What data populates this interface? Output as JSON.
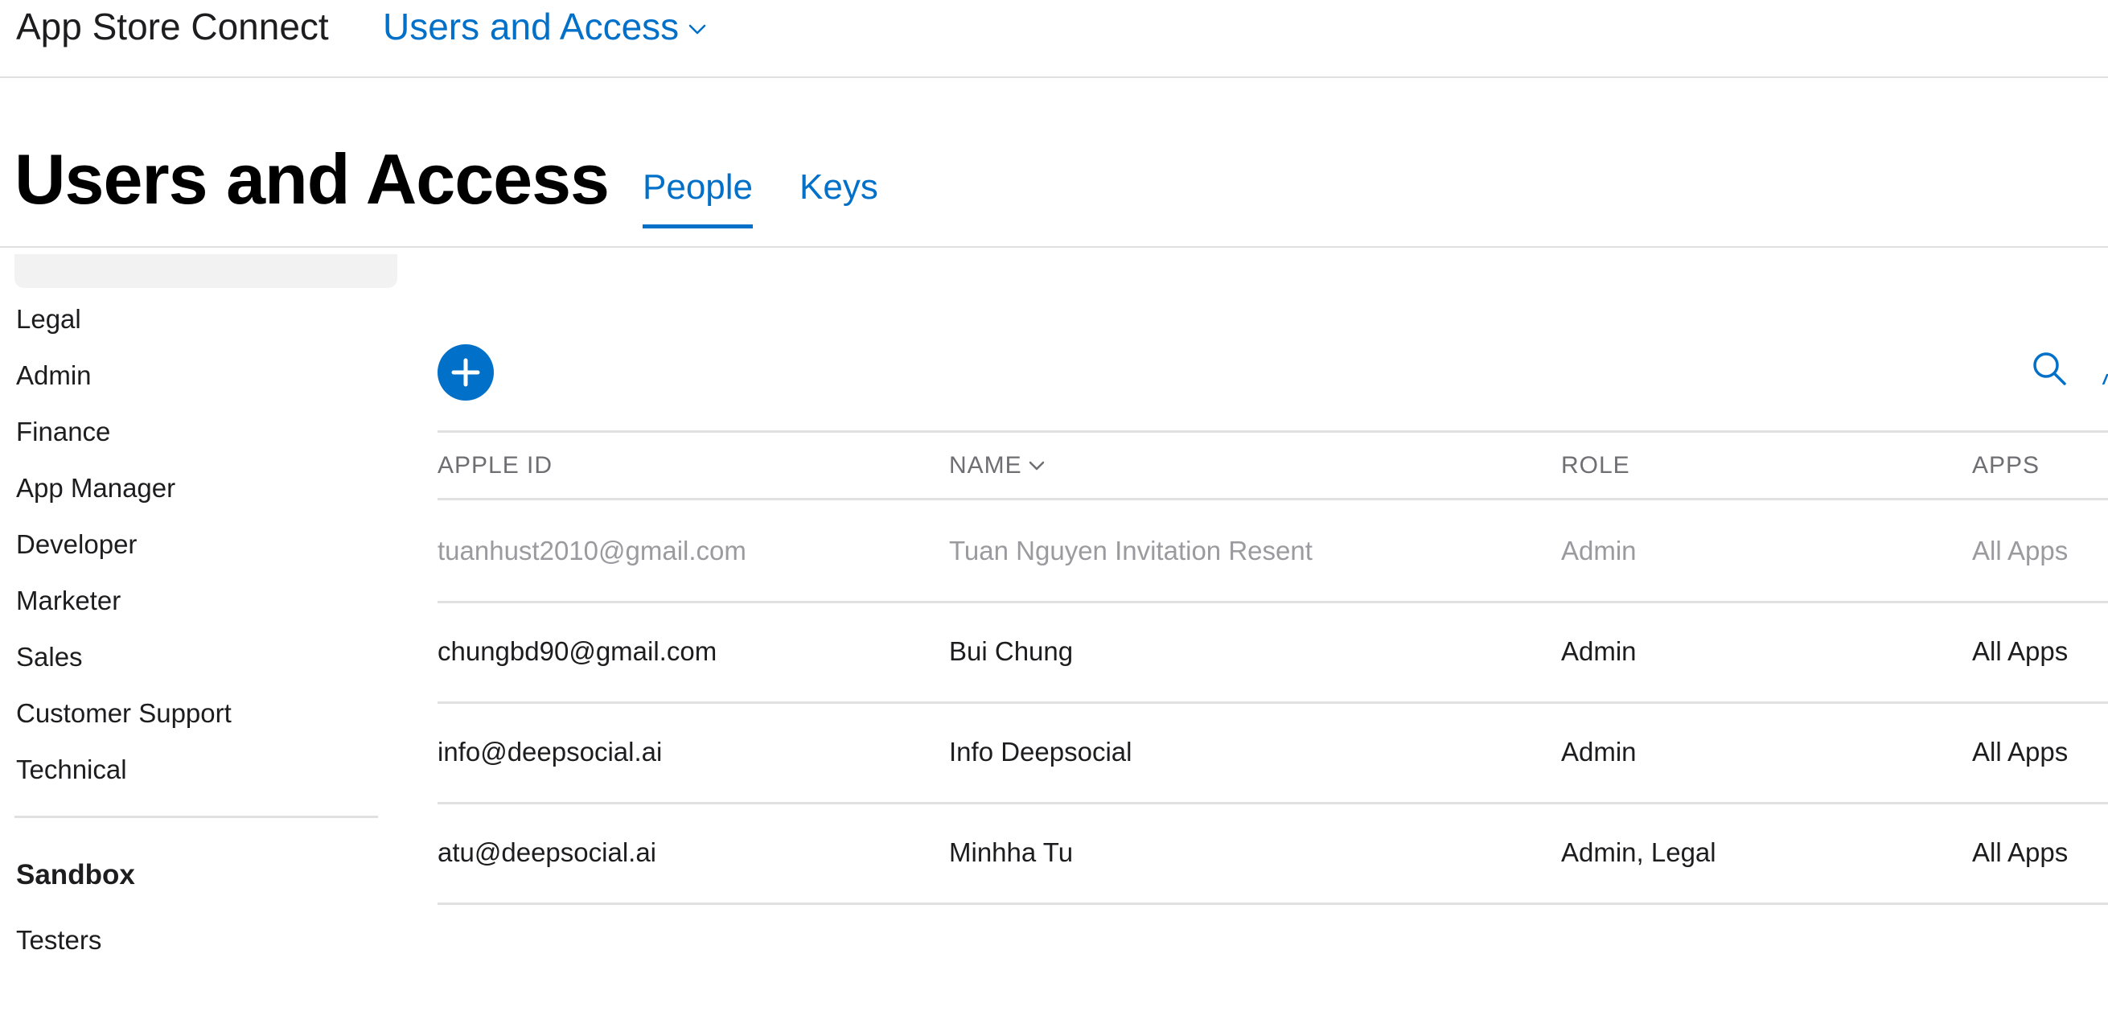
{
  "header": {
    "brand": "App Store Connect",
    "section": "Users and Access"
  },
  "page": {
    "title": "Users and Access",
    "tabs": [
      {
        "label": "People",
        "active": true
      },
      {
        "label": "Keys",
        "active": false
      }
    ]
  },
  "sidebar": {
    "roles": [
      "Legal",
      "Admin",
      "Finance",
      "App Manager",
      "Developer",
      "Marketer",
      "Sales",
      "Customer Support",
      "Technical"
    ],
    "sandbox_heading": "Sandbox",
    "sandbox_items": [
      "Testers"
    ]
  },
  "toolbar": {
    "add_icon": "plus-circle-icon",
    "search_icon": "search-icon"
  },
  "table": {
    "columns": [
      "APPLE ID",
      "NAME",
      "ROLE",
      "APPS"
    ],
    "sorted_column": "NAME",
    "rows": [
      {
        "apple_id": "tuanhust2010@gmail.com",
        "name": "Tuan Nguyen Invitation Resent",
        "role": "Admin",
        "apps": "All Apps",
        "pending": true
      },
      {
        "apple_id": "chungbd90@gmail.com",
        "name": "Bui Chung",
        "role": "Admin",
        "apps": "All Apps",
        "pending": false
      },
      {
        "apple_id": "info@deepsocial.ai",
        "name": "Info Deepsocial",
        "role": "Admin",
        "apps": "All Apps",
        "pending": false
      },
      {
        "apple_id": "atu@deepsocial.ai",
        "name": "Minhha Tu",
        "role": "Admin, Legal",
        "apps": "All Apps",
        "pending": false
      }
    ]
  },
  "colors": {
    "accent": "#0070c9",
    "text": "#1d1d1f",
    "muted": "#6e6e73",
    "pending_text": "#9a9a9f",
    "divider": "#e0e0e0"
  }
}
